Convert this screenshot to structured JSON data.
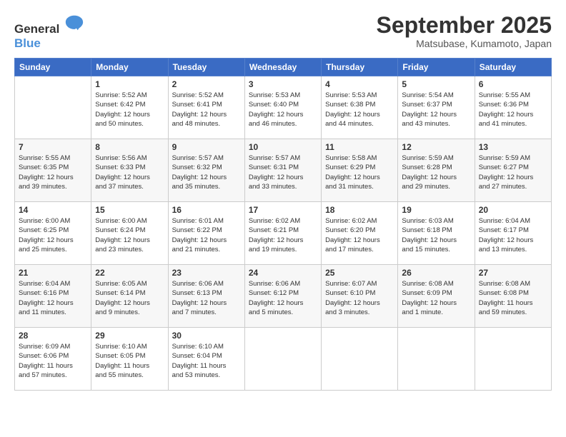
{
  "logo": {
    "general": "General",
    "blue": "Blue"
  },
  "title": "September 2025",
  "location": "Matsubase, Kumamoto, Japan",
  "days_header": [
    "Sunday",
    "Monday",
    "Tuesday",
    "Wednesday",
    "Thursday",
    "Friday",
    "Saturday"
  ],
  "weeks": [
    [
      {
        "day": "",
        "lines": []
      },
      {
        "day": "1",
        "lines": [
          "Sunrise: 5:52 AM",
          "Sunset: 6:42 PM",
          "Daylight: 12 hours",
          "and 50 minutes."
        ]
      },
      {
        "day": "2",
        "lines": [
          "Sunrise: 5:52 AM",
          "Sunset: 6:41 PM",
          "Daylight: 12 hours",
          "and 48 minutes."
        ]
      },
      {
        "day": "3",
        "lines": [
          "Sunrise: 5:53 AM",
          "Sunset: 6:40 PM",
          "Daylight: 12 hours",
          "and 46 minutes."
        ]
      },
      {
        "day": "4",
        "lines": [
          "Sunrise: 5:53 AM",
          "Sunset: 6:38 PM",
          "Daylight: 12 hours",
          "and 44 minutes."
        ]
      },
      {
        "day": "5",
        "lines": [
          "Sunrise: 5:54 AM",
          "Sunset: 6:37 PM",
          "Daylight: 12 hours",
          "and 43 minutes."
        ]
      },
      {
        "day": "6",
        "lines": [
          "Sunrise: 5:55 AM",
          "Sunset: 6:36 PM",
          "Daylight: 12 hours",
          "and 41 minutes."
        ]
      }
    ],
    [
      {
        "day": "7",
        "lines": [
          "Sunrise: 5:55 AM",
          "Sunset: 6:35 PM",
          "Daylight: 12 hours",
          "and 39 minutes."
        ]
      },
      {
        "day": "8",
        "lines": [
          "Sunrise: 5:56 AM",
          "Sunset: 6:33 PM",
          "Daylight: 12 hours",
          "and 37 minutes."
        ]
      },
      {
        "day": "9",
        "lines": [
          "Sunrise: 5:57 AM",
          "Sunset: 6:32 PM",
          "Daylight: 12 hours",
          "and 35 minutes."
        ]
      },
      {
        "day": "10",
        "lines": [
          "Sunrise: 5:57 AM",
          "Sunset: 6:31 PM",
          "Daylight: 12 hours",
          "and 33 minutes."
        ]
      },
      {
        "day": "11",
        "lines": [
          "Sunrise: 5:58 AM",
          "Sunset: 6:29 PM",
          "Daylight: 12 hours",
          "and 31 minutes."
        ]
      },
      {
        "day": "12",
        "lines": [
          "Sunrise: 5:59 AM",
          "Sunset: 6:28 PM",
          "Daylight: 12 hours",
          "and 29 minutes."
        ]
      },
      {
        "day": "13",
        "lines": [
          "Sunrise: 5:59 AM",
          "Sunset: 6:27 PM",
          "Daylight: 12 hours",
          "and 27 minutes."
        ]
      }
    ],
    [
      {
        "day": "14",
        "lines": [
          "Sunrise: 6:00 AM",
          "Sunset: 6:25 PM",
          "Daylight: 12 hours",
          "and 25 minutes."
        ]
      },
      {
        "day": "15",
        "lines": [
          "Sunrise: 6:00 AM",
          "Sunset: 6:24 PM",
          "Daylight: 12 hours",
          "and 23 minutes."
        ]
      },
      {
        "day": "16",
        "lines": [
          "Sunrise: 6:01 AM",
          "Sunset: 6:22 PM",
          "Daylight: 12 hours",
          "and 21 minutes."
        ]
      },
      {
        "day": "17",
        "lines": [
          "Sunrise: 6:02 AM",
          "Sunset: 6:21 PM",
          "Daylight: 12 hours",
          "and 19 minutes."
        ]
      },
      {
        "day": "18",
        "lines": [
          "Sunrise: 6:02 AM",
          "Sunset: 6:20 PM",
          "Daylight: 12 hours",
          "and 17 minutes."
        ]
      },
      {
        "day": "19",
        "lines": [
          "Sunrise: 6:03 AM",
          "Sunset: 6:18 PM",
          "Daylight: 12 hours",
          "and 15 minutes."
        ]
      },
      {
        "day": "20",
        "lines": [
          "Sunrise: 6:04 AM",
          "Sunset: 6:17 PM",
          "Daylight: 12 hours",
          "and 13 minutes."
        ]
      }
    ],
    [
      {
        "day": "21",
        "lines": [
          "Sunrise: 6:04 AM",
          "Sunset: 6:16 PM",
          "Daylight: 12 hours",
          "and 11 minutes."
        ]
      },
      {
        "day": "22",
        "lines": [
          "Sunrise: 6:05 AM",
          "Sunset: 6:14 PM",
          "Daylight: 12 hours",
          "and 9 minutes."
        ]
      },
      {
        "day": "23",
        "lines": [
          "Sunrise: 6:06 AM",
          "Sunset: 6:13 PM",
          "Daylight: 12 hours",
          "and 7 minutes."
        ]
      },
      {
        "day": "24",
        "lines": [
          "Sunrise: 6:06 AM",
          "Sunset: 6:12 PM",
          "Daylight: 12 hours",
          "and 5 minutes."
        ]
      },
      {
        "day": "25",
        "lines": [
          "Sunrise: 6:07 AM",
          "Sunset: 6:10 PM",
          "Daylight: 12 hours",
          "and 3 minutes."
        ]
      },
      {
        "day": "26",
        "lines": [
          "Sunrise: 6:08 AM",
          "Sunset: 6:09 PM",
          "Daylight: 12 hours",
          "and 1 minute."
        ]
      },
      {
        "day": "27",
        "lines": [
          "Sunrise: 6:08 AM",
          "Sunset: 6:08 PM",
          "Daylight: 11 hours",
          "and 59 minutes."
        ]
      }
    ],
    [
      {
        "day": "28",
        "lines": [
          "Sunrise: 6:09 AM",
          "Sunset: 6:06 PM",
          "Daylight: 11 hours",
          "and 57 minutes."
        ]
      },
      {
        "day": "29",
        "lines": [
          "Sunrise: 6:10 AM",
          "Sunset: 6:05 PM",
          "Daylight: 11 hours",
          "and 55 minutes."
        ]
      },
      {
        "day": "30",
        "lines": [
          "Sunrise: 6:10 AM",
          "Sunset: 6:04 PM",
          "Daylight: 11 hours",
          "and 53 minutes."
        ]
      },
      {
        "day": "",
        "lines": []
      },
      {
        "day": "",
        "lines": []
      },
      {
        "day": "",
        "lines": []
      },
      {
        "day": "",
        "lines": []
      }
    ]
  ]
}
